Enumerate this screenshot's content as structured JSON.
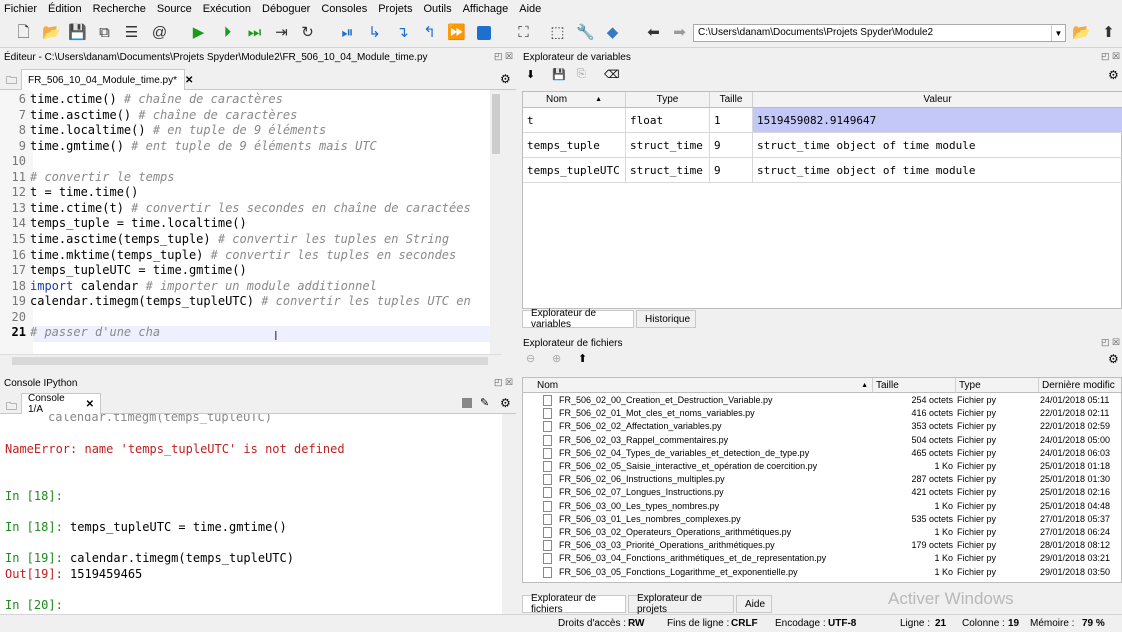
{
  "menu": [
    "Fichier",
    "Édition",
    "Recherche",
    "Source",
    "Exécution",
    "Déboguer",
    "Consoles",
    "Projets",
    "Outils",
    "Affichage",
    "Aide"
  ],
  "toolbar": {
    "path": "C:\\Users\\danam\\Documents\\Projets Spyder\\Module2"
  },
  "editor": {
    "title": "Éditeur - C:\\Users\\danam\\Documents\\Projets Spyder\\Module2\\FR_506_10_04_Module_time.py",
    "tab_label": "FR_506_10_04_Module_time.py*",
    "lines": [
      {
        "n": "6",
        "code": "time.ctime()",
        "comment": " # chaîne de caractères"
      },
      {
        "n": "7",
        "code": "time.asctime()",
        "comment": " # chaîne de caractères"
      },
      {
        "n": "8",
        "code": "time.localtime()",
        "comment": " # en tuple de 9 éléments"
      },
      {
        "n": "9",
        "code": "time.gmtime()",
        "comment": " # ent tuple de 9 éléments mais UTC"
      },
      {
        "n": "10",
        "code": "",
        "comment": ""
      },
      {
        "n": "11",
        "code": "",
        "comment": "# convertir le temps"
      },
      {
        "n": "12",
        "code": "t = time.time()",
        "comment": ""
      },
      {
        "n": "13",
        "code": "time.ctime(t)",
        "comment": " # convertir les secondes en chaîne de caractées"
      },
      {
        "n": "14",
        "code": "temps_tuple = time.localtime()",
        "comment": ""
      },
      {
        "n": "15",
        "code": "time.asctime(temps_tuple)",
        "comment": " # convertir les tuples en String"
      },
      {
        "n": "16",
        "code": "time.mktime(temps_tuple)",
        "comment": " # convertir les tuples en secondes"
      },
      {
        "n": "17",
        "code": "temps_tupleUTC = time.gmtime()",
        "comment": ""
      },
      {
        "n": "18",
        "kw": "import",
        "code": " calendar",
        "comment": " # importer un module additionnel"
      },
      {
        "n": "19",
        "code": "calendar.timegm(temps_tupleUTC)",
        "comment": " # convertir les tuples UTC en"
      },
      {
        "n": "20",
        "code": "",
        "comment": ""
      },
      {
        "n": "21",
        "code": "",
        "comment": "# passer d'une cha"
      }
    ]
  },
  "console": {
    "title": "Console IPython",
    "tab_label": "Console 1/A",
    "lines": [
      {
        "cls": "",
        "text": "calendar.timegm(temps_tupleUTC)"
      },
      {
        "cls": "err",
        "text": "NameError: name 'temps_tupleUTC' is not defined"
      },
      {
        "cls": "inp",
        "text": "In [18]:"
      },
      {
        "cls": "inp",
        "text": "In [18]:",
        "rest": " temps_tupleUTC = time.gmtime()"
      },
      {
        "cls": "inp",
        "text": "In [19]:",
        "rest": " calendar.timegm(temps_tupleUTC)"
      },
      {
        "cls": "out",
        "text": "Out[19]:",
        "rest": " 1519459465"
      },
      {
        "cls": "inp",
        "text": "In [20]:"
      }
    ]
  },
  "variables": {
    "title": "Explorateur de variables",
    "headers": [
      "Nom",
      "Type",
      "Taille",
      "Valeur"
    ],
    "rows": [
      [
        "t",
        "float",
        "1",
        "1519459082.9149647"
      ],
      [
        "temps_tuple",
        "struct_time",
        "9",
        "struct_time object of time module"
      ],
      [
        "temps_tupleUTC",
        "struct_time",
        "9",
        "struct_time object of time module"
      ]
    ],
    "tabs": [
      "Explorateur de variables",
      "Historique"
    ]
  },
  "files": {
    "title": "Explorateur de fichiers",
    "headers": [
      "Nom",
      "Taille",
      "Type",
      "Dernière modific"
    ],
    "rows": [
      [
        "FR_506_02_00_Creation_et_Destruction_Variable.py",
        "254 octets",
        "Fichier py",
        "24/01/2018 05:11"
      ],
      [
        "FR_506_02_01_Mot_cles_et_noms_variables.py",
        "416 octets",
        "Fichier py",
        "22/01/2018 02:11"
      ],
      [
        "FR_506_02_02_Affectation_variables.py",
        "353 octets",
        "Fichier py",
        "22/01/2018 02:59"
      ],
      [
        "FR_506_02_03_Rappel_commentaires.py",
        "504 octets",
        "Fichier py",
        "24/01/2018 05:00"
      ],
      [
        "FR_506_02_04_Types_de_variables_et_detection_de_type.py",
        "465 octets",
        "Fichier py",
        "24/01/2018 06:03"
      ],
      [
        "FR_506_02_05_Saisie_interactive_et_opération de coercition.py",
        "1 Ko",
        "Fichier py",
        "25/01/2018 01:18"
      ],
      [
        "FR_506_02_06_Instructions_multiples.py",
        "287 octets",
        "Fichier py",
        "25/01/2018 01:30"
      ],
      [
        "FR_506_02_07_Longues_Instructions.py",
        "421 octets",
        "Fichier py",
        "25/01/2018 02:16"
      ],
      [
        "FR_506_03_00_Les_types_nombres.py",
        "1 Ko",
        "Fichier py",
        "25/01/2018 04:48"
      ],
      [
        "FR_506_03_01_Les_nombres_complexes.py",
        "535 octets",
        "Fichier py",
        "27/01/2018 05:37"
      ],
      [
        "FR_506_03_02_Operateurs_Operations_arithmétiques.py",
        "1 Ko",
        "Fichier py",
        "27/01/2018 06:24"
      ],
      [
        "FR_506_03_03_Priorité_Operations_arithmétiques.py",
        "179 octets",
        "Fichier py",
        "28/01/2018 08:12"
      ],
      [
        "FR_506_03_04_Fonctions_arithmétiques_et_de_representation.py",
        "1 Ko",
        "Fichier py",
        "29/01/2018 03:21"
      ],
      [
        "FR_506_03_05_Fonctions_Logarithme_et_exponentielle.py",
        "1 Ko",
        "Fichier py",
        "29/01/2018 03:50"
      ]
    ],
    "tabs": [
      "Explorateur de fichiers",
      "Explorateur de projets",
      "Aide"
    ]
  },
  "status": {
    "access_label": "Droits d'accès :",
    "access": "RW",
    "eol_label": "Fins de ligne :",
    "eol": "CRLF",
    "enc_label": "Encodage :",
    "enc": "UTF-8",
    "line_label": "Ligne :",
    "line": "21",
    "col_label": "Colonne :",
    "col": "19",
    "mem_label": "Mémoire :",
    "mem": "79 %"
  },
  "watermark": "Activer Windows"
}
